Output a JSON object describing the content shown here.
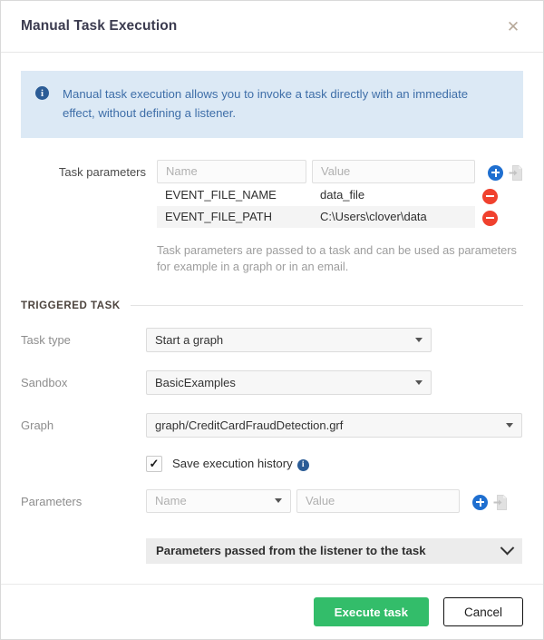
{
  "dialog": {
    "title": "Manual Task Execution",
    "close_icon": "close-icon"
  },
  "banner": {
    "icon": "info-icon",
    "text": "Manual task execution allows you to invoke a task directly with an immediate effect, without defining a listener."
  },
  "task_parameters": {
    "label": "Task parameters",
    "name_placeholder": "Name",
    "value_placeholder": "Value",
    "name_value": "",
    "value_value": "",
    "add_icon": "add-circle-icon",
    "import_icon": "import-file-icon",
    "remove_icon": "remove-circle-icon",
    "columns": [
      "Name",
      "Value"
    ],
    "rows": [
      {
        "name": "EVENT_FILE_NAME",
        "value": "data_file"
      },
      {
        "name": "EVENT_FILE_PATH",
        "value": "C:\\Users\\clover\\data"
      }
    ],
    "helper_text": "Task parameters are passed to a task and can be used as parameters for example in a graph or in an email."
  },
  "section": {
    "triggered_task_title": "TRIGGERED TASK"
  },
  "fields": {
    "task_type": {
      "label": "Task type",
      "value": "Start a graph",
      "caret_icon": "caret-down-icon"
    },
    "sandbox": {
      "label": "Sandbox",
      "value": "BasicExamples",
      "caret_icon": "caret-down-icon"
    },
    "graph": {
      "label": "Graph",
      "value": "graph/CreditCardFraudDetection.grf",
      "caret_icon": "caret-down-icon"
    }
  },
  "save_history": {
    "label": "Save execution history",
    "checked": true,
    "check_icon": "checkmark-icon",
    "info_icon": "info-icon"
  },
  "parameters": {
    "label": "Parameters",
    "name_placeholder": "Name",
    "value_placeholder": "Value",
    "name_value": "",
    "value_value": "",
    "caret_icon": "caret-down-icon",
    "add_icon": "add-circle-icon",
    "import_icon": "import-file-icon"
  },
  "collapsible": {
    "label": "Parameters passed from the listener to the task",
    "chevron_icon": "chevron-down-icon",
    "expanded": false
  },
  "footer": {
    "execute_label": "Execute task",
    "cancel_label": "Cancel"
  },
  "colors": {
    "primary_button": "#33bd6a",
    "banner_bg": "#dce9f5",
    "banner_text": "#3e6ea8",
    "add_icon": "#1f6fd0",
    "remove_icon": "#f0412e",
    "info_icon": "#2b5c96"
  }
}
